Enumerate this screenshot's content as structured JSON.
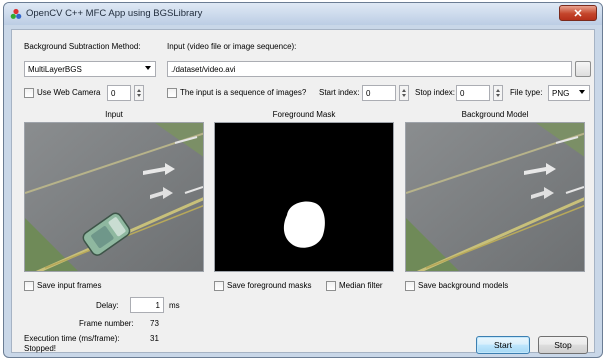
{
  "window": {
    "title": "OpenCV C++ MFC App using BGSLibrary",
    "close_glyph": "✕"
  },
  "form": {
    "method_label": "Background Subtraction Method:",
    "method_value": "MultiLayerBGS",
    "input_label": "Input (video file or image sequence):",
    "input_value": "./dataset/video.avi",
    "webcam_label": "Use Web Camera",
    "webcam_index": "0",
    "sequence_label": "The input is a sequence of images?",
    "start_index_label": "Start index:",
    "start_index_value": "0",
    "stop_index_label": "Stop index:",
    "stop_index_value": "0",
    "file_type_label": "File type:",
    "file_type_value": "PNG"
  },
  "panels": {
    "input_title": "Input",
    "foreground_title": "Foreground Mask",
    "background_title": "Background Model"
  },
  "options": {
    "save_input_label": "Save input frames",
    "save_foreground_label": "Save foreground masks",
    "median_filter_label": "Median filter",
    "save_background_label": "Save background models"
  },
  "stats": {
    "delay_label": "Delay:",
    "delay_value": "1",
    "delay_unit": "ms",
    "frame_number_label": "Frame number:",
    "frame_number_value": "73",
    "exec_time_label": "Execution time (ms/frame):",
    "exec_time_value": "31",
    "status": "Stopped!"
  },
  "buttons": {
    "start": "Start",
    "stop": "Stop"
  },
  "icons": [
    "app-icon",
    "close-icon",
    "browse-icon",
    "chevron-down-icon",
    "spin-up-icon",
    "spin-down-icon"
  ],
  "colors": {
    "title_gradient_top": "#dfe9f5",
    "close_red": "#c4452b",
    "client_bg": "#f0f0f0",
    "mask_bg": "#000000"
  }
}
